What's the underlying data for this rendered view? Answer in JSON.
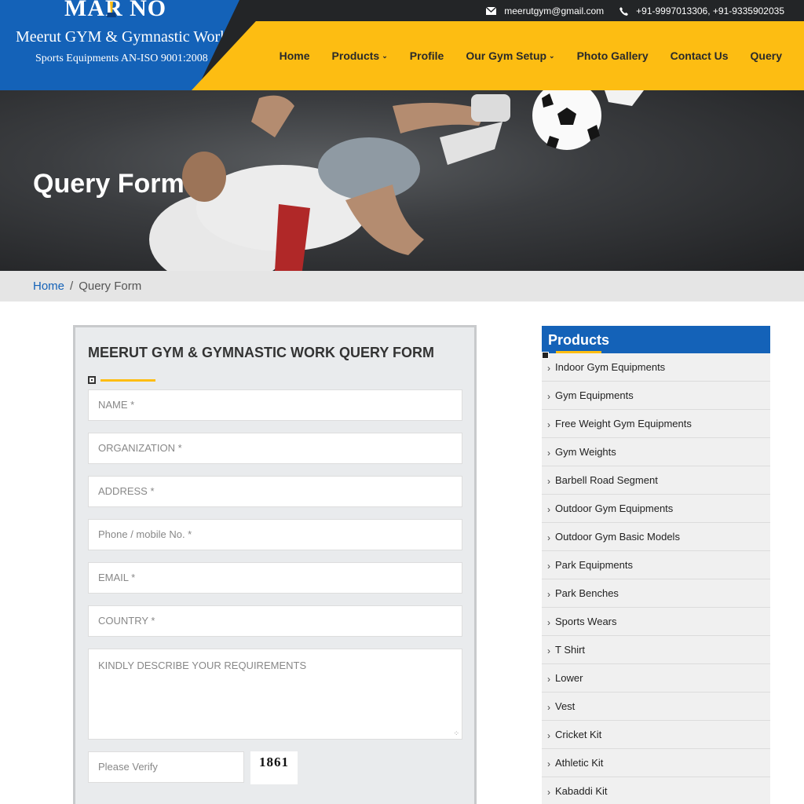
{
  "header": {
    "brand": "MAR  NO",
    "company": "Meerut GYM & Gymnastic Work",
    "tagline": "Sports Equipments AN-ISO 9001:2008",
    "email": "meerutgym@gmail.com",
    "phone": "+91-9997013306, +91-9335902035",
    "email_icon": "envelope-icon",
    "phone_icon": "phone-icon"
  },
  "nav": {
    "items": [
      "Home",
      "Products",
      "Profile",
      "Our Gym Setup",
      "Photo Gallery",
      "Contact Us",
      "Query"
    ]
  },
  "banner": {
    "title": "Query Form"
  },
  "breadcrumb": {
    "home": "Home",
    "separator": "/",
    "current": "Query Form"
  },
  "form": {
    "title": "MEERUT GYM & GYMNASTIC WORK QUERY FORM",
    "name_placeholder": "NAME *",
    "organization_placeholder": "ORGANIZATION *",
    "address_placeholder": "ADDRESS *",
    "phone_placeholder": "Phone / mobile No. *",
    "email_placeholder": "EMAIL *",
    "country_placeholder": "COUNTRY *",
    "requirements_placeholder": "KINDLY DESCRIBE YOUR REQUIREMENTS",
    "verify_placeholder": "Please Verify",
    "captcha": "1861"
  },
  "sidebar": {
    "title": "Products",
    "items": [
      "Indoor Gym Equipments",
      "Gym Equipments",
      "Free Weight Gym Equipments",
      "Gym Weights",
      "Barbell Road Segment",
      "Outdoor Gym Equipments",
      "Outdoor Gym Basic Models",
      "Park Equipments",
      "Park Benches",
      "Sports Wears",
      "T Shirt",
      "Lower",
      "Vest",
      "Cricket Kit",
      "Athletic Kit",
      "Kabaddi Kit"
    ]
  },
  "colors": {
    "brand_blue": "#1462b8",
    "accent_yellow": "#fdbd12",
    "dark": "#232527"
  }
}
